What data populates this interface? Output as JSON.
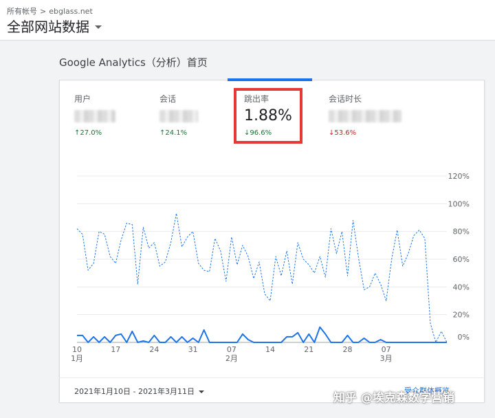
{
  "breadcrumb": {
    "account": "所有帐号",
    "separator": ">",
    "property": "ebglass.net"
  },
  "header": {
    "title": "全部网站数据"
  },
  "section": {
    "title": "Google Analytics（分析）首页"
  },
  "metrics": [
    {
      "label": "用户",
      "value": "",
      "change": "↑27.0%",
      "direction": "up"
    },
    {
      "label": "会话",
      "value": "",
      "change": "↑24.1%",
      "direction": "up"
    },
    {
      "label": "跳出率",
      "value": "1.88%",
      "change": "↓96.6%",
      "direction": "down-good"
    },
    {
      "label": "会话时长",
      "value": "",
      "change": "↓53.6%",
      "direction": "down"
    }
  ],
  "colors": {
    "accent": "#1a73e8",
    "highlight": "#e53935",
    "up": "#137333",
    "down": "#c5221f"
  },
  "chart_data": {
    "type": "line",
    "y_ticks": [
      "0%",
      "20%",
      "40%",
      "60%",
      "80%",
      "100%",
      "120%"
    ],
    "ylim": [
      0,
      120
    ],
    "x_ticks": [
      {
        "day": "10",
        "month": "1月"
      },
      {
        "day": "17",
        "month": ""
      },
      {
        "day": "24",
        "month": ""
      },
      {
        "day": "31",
        "month": ""
      },
      {
        "day": "07",
        "month": "2月"
      },
      {
        "day": "14",
        "month": ""
      },
      {
        "day": "21",
        "month": ""
      },
      {
        "day": "28",
        "month": ""
      },
      {
        "day": "07",
        "month": "3月"
      }
    ],
    "series": [
      {
        "style": "dashed",
        "values": [
          82,
          78,
          52,
          57,
          80,
          78,
          62,
          57,
          74,
          86,
          85,
          42,
          83,
          68,
          72,
          55,
          58,
          72,
          93,
          69,
          76,
          80,
          57,
          52,
          51,
          75,
          66,
          44,
          76,
          56,
          70,
          62,
          46,
          58,
          35,
          30,
          62,
          48,
          66,
          42,
          72,
          60,
          56,
          50,
          62,
          47,
          82,
          64,
          80,
          48,
          88,
          61,
          38,
          40,
          50,
          42,
          30,
          60,
          81,
          55,
          64,
          77,
          81,
          75,
          14,
          0,
          8,
          0
        ]
      },
      {
        "style": "solid",
        "values": [
          5,
          5,
          0,
          4,
          0,
          4,
          0,
          5,
          6,
          0,
          8,
          0,
          1,
          0,
          5,
          0,
          0,
          4,
          0,
          4,
          0,
          3,
          0,
          9,
          0,
          0,
          0,
          0,
          0,
          0,
          6,
          2,
          0,
          0,
          0,
          0,
          0,
          0,
          4,
          4,
          7,
          0,
          6,
          0,
          11,
          6,
          0,
          0,
          0,
          5,
          0,
          0,
          3,
          0,
          0,
          2,
          0,
          0,
          0,
          0,
          0,
          0,
          0,
          0,
          0,
          0,
          0,
          0
        ]
      }
    ]
  },
  "footer": {
    "date_range": "2021年1月10日 - 2021年3月11日",
    "report_link": "受众群体概览"
  },
  "watermark": "知乎 @埃克森数字营销"
}
